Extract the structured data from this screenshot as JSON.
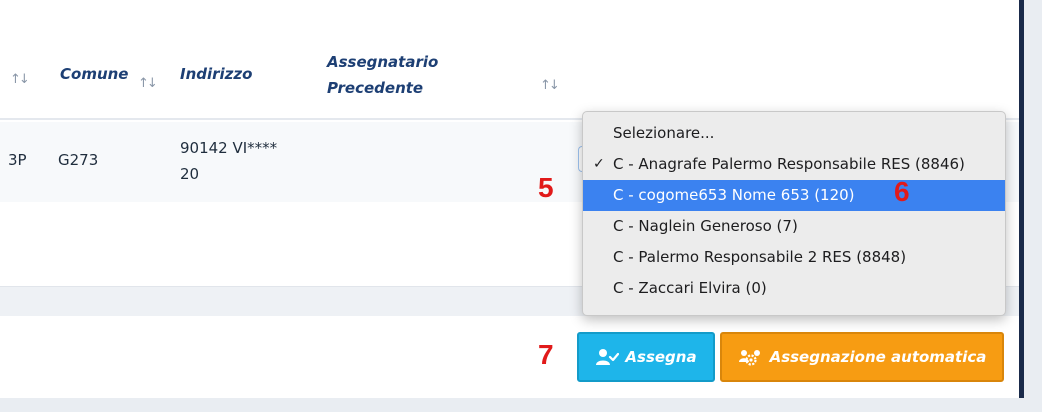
{
  "table": {
    "headers": {
      "prev_sort": "↑↓",
      "comune": "Comune",
      "comune_sort": "↑↓",
      "indirizzo": "Indirizzo",
      "assegnatario_line1": "Assegnatario",
      "assegnatario_line2": "Precedente",
      "assegnatario_sort": "↑↓"
    },
    "row": {
      "prev_fragment": "3P",
      "comune": "G273",
      "indirizzo_line1": "90142 VI****",
      "indirizzo_line2": "20"
    }
  },
  "dropdown": {
    "options": [
      {
        "label": "Selezionare...",
        "checked": false,
        "highlighted": false
      },
      {
        "label": "C - Anagrafe Palermo Responsabile RES (8846)",
        "checked": true,
        "highlighted": false
      },
      {
        "label": "C - cogome653 Nome 653 (120)",
        "checked": false,
        "highlighted": true
      },
      {
        "label": "C - Naglein Generoso (7)",
        "checked": false,
        "highlighted": false
      },
      {
        "label": "C - Palermo Responsabile 2 RES (8848)",
        "checked": false,
        "highlighted": false
      },
      {
        "label": "C - Zaccari Elvira (0)",
        "checked": false,
        "highlighted": false
      }
    ],
    "check_glyph": "✓"
  },
  "markers": {
    "m5": "5",
    "m6": "6",
    "m7": "7"
  },
  "buttons": {
    "assegna_label": "Assegna",
    "assegna_icon": "user-check-icon",
    "auto_label": "Assegnazione automatica",
    "auto_icon": "users-gear-icon"
  },
  "colors": {
    "header_text": "#1d3f74",
    "highlight": "#3b82f0",
    "assegna_bg": "#1eb5ea",
    "auto_bg": "#f79c12",
    "marker": "#e11a1a"
  }
}
